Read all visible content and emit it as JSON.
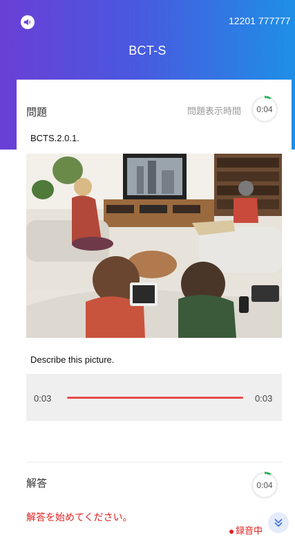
{
  "header": {
    "speaker_icon": "speaker-icon",
    "number": "12201 777777",
    "title": "BCT-S",
    "gradient_colors": [
      "#6a3fd6",
      "#1f8fe6"
    ]
  },
  "question": {
    "label": "問題",
    "display_time_label": "問題表示時間",
    "timer": "0:04",
    "timer_progress": 0.08,
    "id": "BCTS.2.0.1.",
    "prompt": "Describe this picture."
  },
  "player": {
    "start_time": "0:03",
    "end_time": "0:03",
    "progress": 1.0,
    "bar_color": "#e84a4a"
  },
  "answer": {
    "label": "解答",
    "timer": "0:04",
    "timer_progress": 0.08,
    "instruction": "解答を始めてください。",
    "recording_label": "録音中",
    "expand_icon": "double-chevron-down-icon"
  },
  "colors": {
    "accent": "#2db45a",
    "alert": "#e02020"
  }
}
